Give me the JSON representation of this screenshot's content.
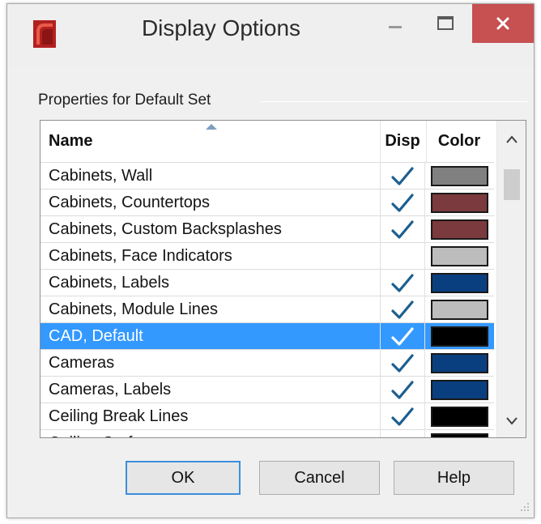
{
  "window": {
    "title": "Display Options",
    "close_glyph": "✕",
    "accent_close": "#c75050"
  },
  "group": {
    "label": "Properties for Default Set"
  },
  "columns": {
    "name": "Name",
    "disp": "Disp",
    "color": "Color"
  },
  "rows": [
    {
      "name": "Cabinets,  Wall",
      "disp": true,
      "color": "#808080"
    },
    {
      "name": "Cabinets, Countertops",
      "disp": true,
      "color": "#7a3a3e"
    },
    {
      "name": "Cabinets, Custom Backsplashes",
      "disp": true,
      "color": "#7a3a3e"
    },
    {
      "name": "Cabinets, Face Indicators",
      "disp": false,
      "color": "#bdbdbd"
    },
    {
      "name": "Cabinets, Labels",
      "disp": true,
      "color": "#0a3f7f"
    },
    {
      "name": "Cabinets, Module Lines",
      "disp": true,
      "color": "#bdbdbd"
    },
    {
      "name": "CAD,  Default",
      "disp": true,
      "color": "#000000",
      "selected": true
    },
    {
      "name": "Cameras",
      "disp": true,
      "color": "#0a3f7f"
    },
    {
      "name": "Cameras, Labels",
      "disp": true,
      "color": "#0a3f7f"
    },
    {
      "name": "Ceiling Break Lines",
      "disp": true,
      "color": "#000000"
    },
    {
      "name": "Ceiling Surfaces",
      "disp": false,
      "color": "#000000"
    }
  ],
  "check_color": "#1c5f8f",
  "selection_color": "#3399ff",
  "buttons": {
    "ok": "OK",
    "cancel": "Cancel",
    "help": "Help"
  },
  "icons": {
    "app": "chief-architect-icon",
    "minimize": "minimize-icon",
    "maximize": "maximize-icon",
    "close": "close-icon",
    "check": "checkmark-icon",
    "scroll_up": "chevron-up-icon",
    "scroll_down": "chevron-down-icon"
  }
}
